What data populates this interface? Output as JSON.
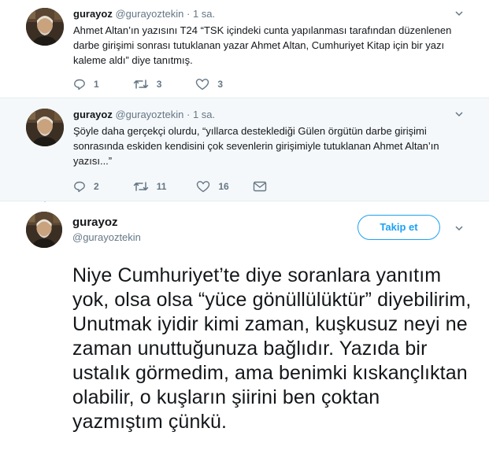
{
  "tweets": [
    {
      "name": "gurayoz",
      "handle": "@gurayoztekin",
      "dot": "·",
      "time": "1 sa.",
      "text": "Ahmet Altan’ın yazısını T24 “TSK içindeki cunta yapılanması tarafından düzenlenen darbe girişimi sonrası tutuklanan yazar Ahmet Altan, Cumhuriyet Kitap için bir yazı kaleme aldı” diye tanıtmış.",
      "replies": "1",
      "retweets": "3",
      "likes": "3"
    },
    {
      "name": "gurayoz",
      "handle": "@gurayoztekin",
      "dot": "·",
      "time": "1 sa.",
      "text": "Şöyle daha gerçekçi olurdu, “yıllarca desteklediği Gülen örgütün darbe girişimi sonrasında eskiden kendisini çok sevenlerin girişimiyle tutuklanan Ahmet Altan’ın yazısı...”",
      "replies": "2",
      "retweets": "11",
      "likes": "16"
    }
  ],
  "main_tweet": {
    "name": "gurayoz",
    "handle": "@gurayoztekin",
    "follow_label": "Takip et",
    "text": "Niye Cumhuriyet’te diye soranlara yanıtım yok, olsa olsa “yüce gönüllülüktür” diyebilirim, Unutmak iyidir kimi zaman, kuşkusuz neyi ne zaman unuttuğunuza bağlıdır. Yazıda bir ustalık görmedim, ama benimki kıskançlıktan olabilir, o kuşların şiirini ben çoktan yazmıştım çünkü."
  },
  "icons": {
    "reply": "reply-icon",
    "retweet": "retweet-icon",
    "like": "heart-icon",
    "dm": "envelope-icon",
    "more": "chevron-down-icon"
  },
  "colors": {
    "accent": "#1da1f2",
    "secondary_text": "#657786",
    "thread_line": "#ccd6dd",
    "reply_bg": "#f5f8fa"
  }
}
